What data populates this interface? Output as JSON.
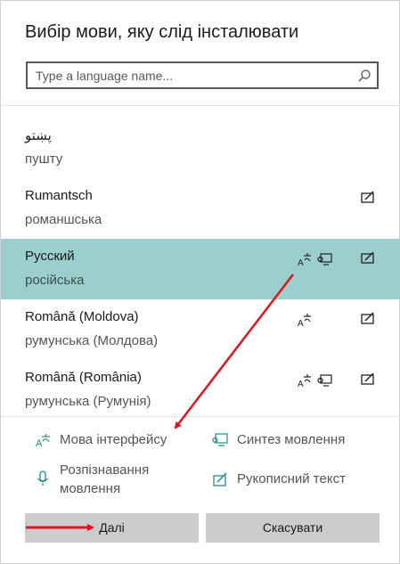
{
  "dialog": {
    "title": "Вибір мови, яку слід інсталювати",
    "search": {
      "placeholder": "Type a language name...",
      "value": ""
    }
  },
  "languages": [
    {
      "native": "پښتو",
      "local": "пушту",
      "selected": false,
      "features": []
    },
    {
      "native": "Rumantsch",
      "local": "романшська",
      "selected": false,
      "features": [
        "handwriting"
      ]
    },
    {
      "native": "Русский",
      "local": "російська",
      "selected": true,
      "features": [
        "display-language",
        "speech-synthesis",
        "handwriting"
      ]
    },
    {
      "native": "Română (Moldova)",
      "local": "румунська (Молдова)",
      "selected": false,
      "features": [
        "display-language",
        "handwriting"
      ]
    },
    {
      "native": "Română (România)",
      "local": "румунська (Румунія)",
      "selected": false,
      "features": [
        "display-language",
        "speech-synthesis",
        "handwriting"
      ]
    }
  ],
  "legend": {
    "display_language": "Мова інтерфейсу",
    "speech_synthesis": "Синтез мовлення",
    "speech_recognition_line1": "Розпізнавання",
    "speech_recognition_line2": "мовлення",
    "handwriting": "Рукописний текст"
  },
  "buttons": {
    "next": "Далі",
    "cancel": "Скасувати"
  },
  "colors": {
    "selected_row": "#9bcfcd",
    "icon_teal": "#1b8f8a",
    "annotation_arrow": "#e0141b",
    "button_bg": "#cccccc"
  }
}
